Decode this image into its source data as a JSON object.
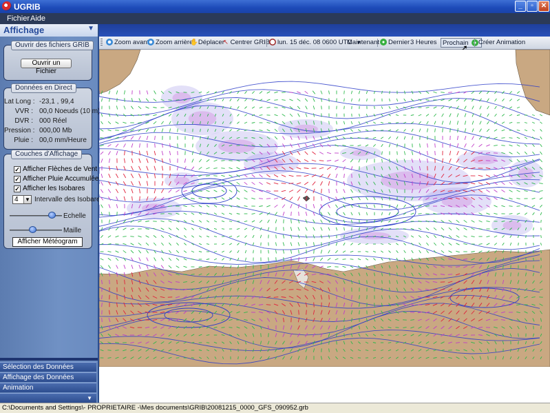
{
  "window": {
    "title": "UGRIB"
  },
  "menu": {
    "file": "Fichier",
    "help": "Aide"
  },
  "sidebar": {
    "title": "Affichage",
    "open_group": {
      "title": "Ouvrir des fichiers GRIB",
      "button": "Ouvrir un Fichier"
    },
    "live_group": {
      "title": "Données en Direct",
      "rows": [
        {
          "label": "Lat Long :",
          "value": "-23,1 ,  99,4"
        },
        {
          "label": "VVR :",
          "value": "00,0 Noeuds (10 m)"
        },
        {
          "label": "DVR :",
          "value": "000 Réel"
        },
        {
          "label": "Pression :",
          "value": "000,00 Mb"
        },
        {
          "label": "Pluie :",
          "value": "00,0 mm/Heure"
        }
      ]
    },
    "layers_group": {
      "title": "Couches d'Affichage",
      "checkboxes": [
        {
          "label": "Afficher Flèches de Vent",
          "checked": true
        },
        {
          "label": "Afficher Pluie Accumulée",
          "checked": true
        },
        {
          "label": "Afficher les Isobares",
          "checked": true
        }
      ],
      "isobar_interval": {
        "value": "4",
        "label": "Intervalle des Isobares"
      },
      "scale_label": "Echelle",
      "scale_level": 0.82,
      "mesh_label": "Maille",
      "mesh_level": 0.45,
      "meteogram_button": "Afficher Météogram"
    },
    "bottom_tabs": [
      "Sélection des Données",
      "Affichage des Données",
      "Animation"
    ]
  },
  "toolbar": {
    "zoom_in": "Zoom avant",
    "zoom_out": "Zoom arrière",
    "move": "Déplacer",
    "center": "Centrer GRIB",
    "datetime": "lun. 15 déc. 08 0600 UTC",
    "now": "Maintenant",
    "last": "Dernier",
    "step": "3 Heures",
    "next": "Prochain",
    "animate": "Créer Animation"
  },
  "status": {
    "path": "C:\\Documents and Settings\\- PROPRIETAIRE -\\Mes documents\\GRIB\\20081215_0000_GFS_090952.grb"
  },
  "colors": {
    "land": "#c9a882",
    "ocean": "#ffffff",
    "isobar": "#2c3cc8",
    "rain": "#9a8ee6",
    "arrow_green": "#2bb84a",
    "arrow_red": "#e0203a",
    "arrow_magenta": "#c03cc8"
  }
}
